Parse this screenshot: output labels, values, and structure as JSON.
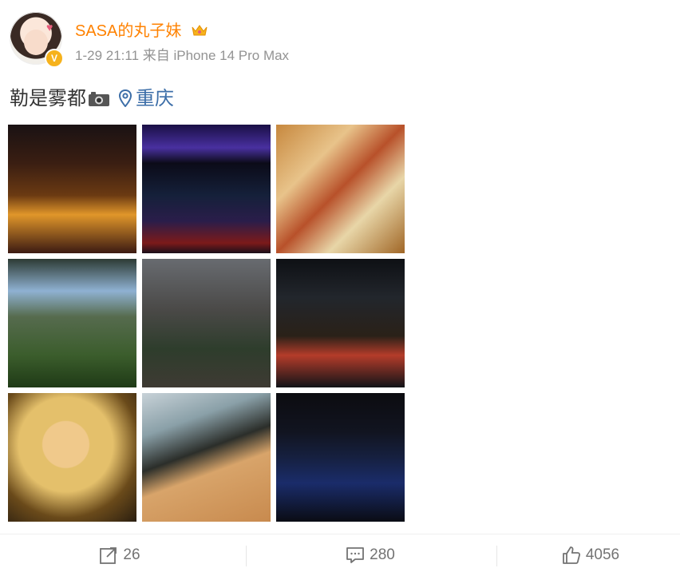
{
  "user": {
    "name": "SASA的丸子妹",
    "verified_badge": "V",
    "meta": "1-29 21:11 来自 iPhone 14 Pro Max"
  },
  "post": {
    "text": "勒是雾都",
    "location": "重庆"
  },
  "actions": {
    "reposts": "26",
    "comments": "280",
    "likes": "4056"
  },
  "colors": {
    "username": "#ff8200",
    "location": "#3c6ea8",
    "muted": "#939393",
    "badge": "#f6b21c"
  },
  "icons": [
    "vip-crown-icon",
    "camera-icon",
    "location-pin-icon",
    "repost-icon",
    "comment-icon",
    "like-icon"
  ]
}
